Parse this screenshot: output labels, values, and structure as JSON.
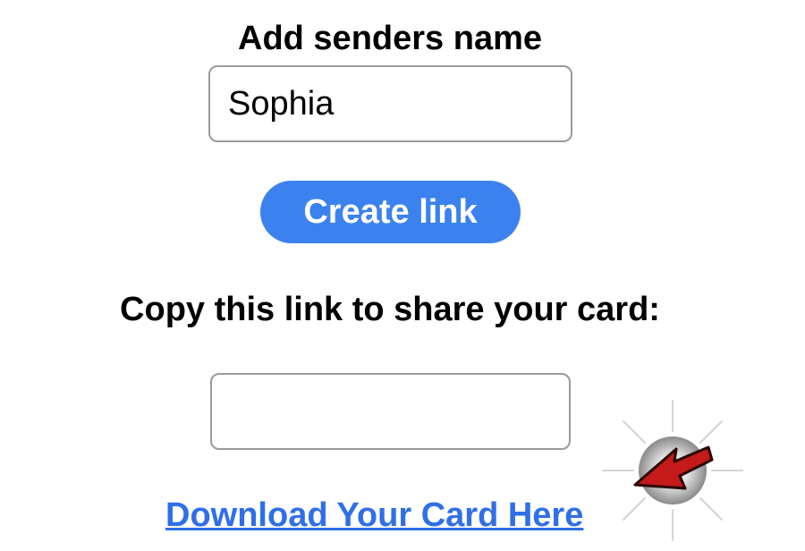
{
  "sender": {
    "label": "Add senders name",
    "value": "Sophia"
  },
  "create_button": {
    "label": "Create link",
    "color": "#3b82ef"
  },
  "share": {
    "label": "Copy this link to share your card:",
    "value": ""
  },
  "download": {
    "label": "Download Your Card Here",
    "color": "#2f6fe8"
  },
  "pointer": {
    "icon": "red-arrow-pointer-icon",
    "color": "#c41a1a"
  }
}
